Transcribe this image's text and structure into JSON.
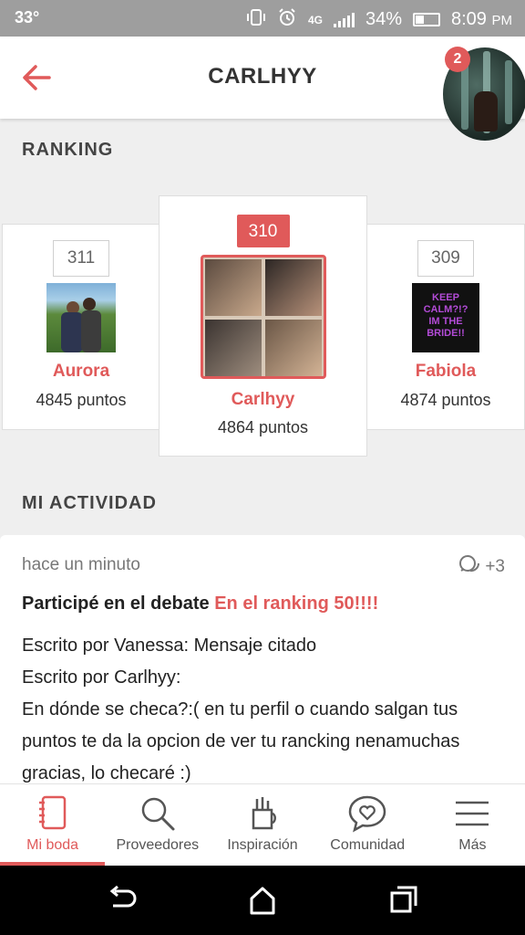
{
  "status_bar": {
    "left_text": "33°",
    "signal_label": "4G",
    "battery": "34%",
    "battery_level": 0.34,
    "time": "8:09",
    "ampm": "PM"
  },
  "header": {
    "title": "CARLHYY",
    "notification_count": "2"
  },
  "ranking": {
    "section_title": "RANKING",
    "entries": [
      {
        "rank": "311",
        "name": "Aurora",
        "points": "4845 puntos"
      },
      {
        "rank": "310",
        "name": "Carlhyy",
        "points": "4864 puntos"
      },
      {
        "rank": "309",
        "name": "Fabiola",
        "points": "4874 puntos"
      }
    ],
    "fabiola_photo_text": [
      "KEEP",
      "CALM?!?",
      "IM THE",
      "BRIDE!!"
    ]
  },
  "activity": {
    "section_title": "MI ACTIVIDAD",
    "time": "hace un minuto",
    "comment_count": "+3",
    "headline_prefix": "Participé en el debate ",
    "headline_link": "En el ranking 50!!!!",
    "lines": [
      "Escrito por Vanessa: Mensaje citado",
      "Escrito por Carlhyy:",
      "En dónde se checa?:( en tu perfil o cuando salgan tus puntos te da la opcion de ver tu rancking nenamuchas gracias, lo checaré :)"
    ]
  },
  "bottom_nav": [
    {
      "label": "Mi boda",
      "icon": "notebook-icon"
    },
    {
      "label": "Proveedores",
      "icon": "search-icon"
    },
    {
      "label": "Inspiración",
      "icon": "pencil-cup-icon"
    },
    {
      "label": "Comunidad",
      "icon": "heart-bubble-icon"
    },
    {
      "label": "Más",
      "icon": "menu-icon"
    }
  ],
  "colors": {
    "accent": "#e05a5a",
    "status_bar": "#9e9e9e",
    "background": "#efefef"
  }
}
